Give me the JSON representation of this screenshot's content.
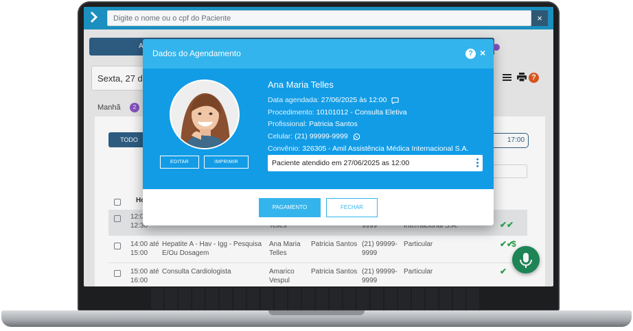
{
  "app": {
    "search_placeholder": "Digite o nome ou o cpf do Paciente",
    "search_clear": "×",
    "menu_icon": "chevron-right-icon"
  },
  "background": {
    "tab_partial": "A",
    "date_text": "Sexta, 27 de",
    "shift_label": "Manhã",
    "shift_count": "2",
    "todos_label": "TODO",
    "time_label": "17:00",
    "hour_header": "Ho",
    "rows": [
      {
        "time1": "12:0",
        "time2": "12:30",
        "procedure1": "",
        "procedure2": "",
        "patient1": "",
        "patient2": "Telles",
        "professional": "",
        "phone1": "",
        "phone2": "9999",
        "insurance1": "",
        "insurance2": "Internacional S.A."
      },
      {
        "time1": "14:00 até",
        "time2": "15:00",
        "procedure1": "Hepatite A - Hav - Igg - Pesquisa",
        "procedure2": "E/Ou Dosagem",
        "patient1": "Ana Maria",
        "patient2": "Telles",
        "professional": "Patricia Santos",
        "phone1": "(21) 99999-",
        "phone2": "9999",
        "insurance1": "Particular",
        "insurance2": ""
      },
      {
        "time1": "15:00 até",
        "time2": "16:00",
        "procedure1": "Consulta Cardiologista",
        "procedure2": "",
        "patient1": "Amarico",
        "patient2": "Vespul",
        "professional": "Patricia Santos",
        "phone1": "(21) 99999-",
        "phone2": "9999",
        "insurance1": "Particular",
        "insurance2": ""
      }
    ]
  },
  "modal": {
    "title": "Dados do Agendamento",
    "help": "?",
    "close": "×",
    "patient_name": "Ana Maria Telles",
    "fields": {
      "date_label": "Data agendada:",
      "date_value": "27/06/2025 às 12:00",
      "procedure_label": "Procedimento:",
      "procedure_value": "10101012 - Consulta Eletiva",
      "professional_label": "Profissional:",
      "professional_value": "Patricia Santos",
      "phone_label": "Celular:",
      "phone_value": "(21) 99999-9999",
      "insurance_label": "Convênio:",
      "insurance_value": "326305 - Amil Assistência Médica Internacional S.A."
    },
    "status_text": "Paciente atendido em 27/06/2025 as 12:00",
    "edit_button": "EDITAR",
    "print_button": "IMPRIMIR",
    "payment_button": "PAGAMENTO",
    "close_button": "FECHAR"
  },
  "colors": {
    "modal_header": "#34b4ec",
    "modal_body": "#129ce6",
    "topbar": "#1b8fbf",
    "success": "#2aa44a",
    "fab": "#1f8a5a"
  }
}
